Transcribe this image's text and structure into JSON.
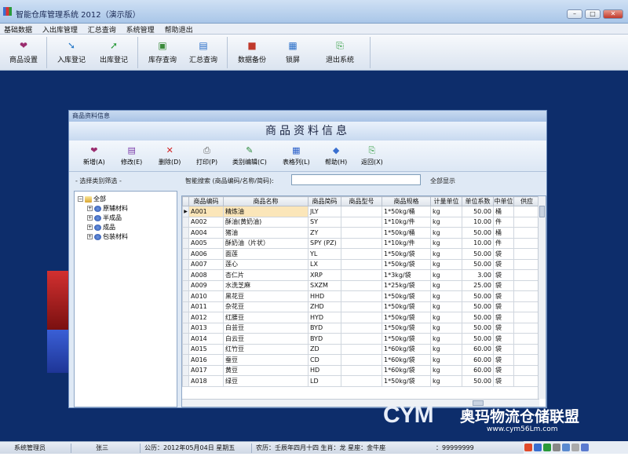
{
  "window": {
    "title": "智能仓库管理系统 2012（演示版）",
    "buttons": {
      "minimize": "–",
      "maximize": "□",
      "close": "✕"
    }
  },
  "menubar": [
    "基础数据",
    "入出库管理",
    "汇总查询",
    "系统管理",
    "帮助退出"
  ],
  "toolbar": {
    "groups": [
      [
        {
          "label": "商品设置",
          "icon": "goods-settings-icon"
        }
      ],
      [
        {
          "label": "入库登记",
          "icon": "stock-in-icon"
        },
        {
          "label": "出库登记",
          "icon": "stock-out-icon"
        }
      ],
      [
        {
          "label": "库存查询",
          "icon": "inventory-query-icon"
        },
        {
          "label": "汇总查询",
          "icon": "summary-query-icon"
        }
      ],
      [
        {
          "label": "数据备份",
          "icon": "backup-icon"
        },
        {
          "label": "锁屏",
          "icon": "lock-screen-icon"
        },
        {
          "label": "退出系统",
          "icon": "exit-icon"
        }
      ]
    ]
  },
  "dialog": {
    "title": "商品资料信息",
    "banner": "商品资料信息",
    "buttons": [
      {
        "label": "新增(A)",
        "icon": "add-icon"
      },
      {
        "label": "修改(E)",
        "icon": "edit-icon"
      },
      {
        "label": "删除(D)",
        "icon": "delete-icon"
      },
      {
        "label": "打印(P)",
        "icon": "print-icon"
      },
      {
        "label": "类别编辑(C)",
        "icon": "category-edit-icon"
      },
      {
        "label": "表格列(L)",
        "icon": "table-columns-icon"
      },
      {
        "label": "帮助(H)",
        "icon": "help-icon"
      },
      {
        "label": "返回(X)",
        "icon": "return-icon"
      }
    ],
    "category_caption": "- 选择类别筛选 -",
    "search_label": "智能搜索 (商品编码/名称/简码):",
    "search_value": "",
    "show_all": "全部显示",
    "tree": [
      {
        "label": "全部",
        "level": 0,
        "expander": "−"
      },
      {
        "label": "原辅材料",
        "level": 1,
        "expander": "+"
      },
      {
        "label": "半成品",
        "level": 1,
        "expander": "+"
      },
      {
        "label": "成品",
        "level": 1,
        "expander": "+"
      },
      {
        "label": "包装材料",
        "level": 1,
        "expander": "+"
      }
    ],
    "table": {
      "columns": [
        "商品编码",
        "商品名称",
        "商品简码",
        "商品型号",
        "商品规格",
        "计量单位",
        "单位系数",
        "中单位",
        "供应"
      ],
      "rows": [
        [
          "A001",
          "精炼油",
          "JLY",
          "",
          "1*50kg/桶",
          "kg",
          "50.00",
          "桶",
          ""
        ],
        [
          "A002",
          "酥油(黄奶油)",
          "SY",
          "",
          "1*10kg/件",
          "kg",
          "10.00",
          "件",
          ""
        ],
        [
          "A004",
          "猪油",
          "ZY",
          "",
          "1*50kg/桶",
          "kg",
          "50.00",
          "桶",
          ""
        ],
        [
          "A005",
          "酥奶油（片状）",
          "SPY (PZ)",
          "",
          "1*10kg/件",
          "kg",
          "10.00",
          "件",
          ""
        ],
        [
          "A006",
          "面莲",
          "YL",
          "",
          "1*50kg/袋",
          "kg",
          "50.00",
          "袋",
          ""
        ],
        [
          "A007",
          "莲心",
          "LX",
          "",
          "1*50kg/袋",
          "kg",
          "50.00",
          "袋",
          ""
        ],
        [
          "A008",
          "杏仁片",
          "XRP",
          "",
          "1*3kg/袋",
          "kg",
          "3.00",
          "袋",
          ""
        ],
        [
          "A009",
          "水洗芝麻",
          "SXZM",
          "",
          "1*25kg/袋",
          "kg",
          "25.00",
          "袋",
          ""
        ],
        [
          "A010",
          "黑花豆",
          "HHD",
          "",
          "1*50kg/袋",
          "kg",
          "50.00",
          "袋",
          ""
        ],
        [
          "A011",
          "杂花豆",
          "ZHD",
          "",
          "1*50kg/袋",
          "kg",
          "50.00",
          "袋",
          ""
        ],
        [
          "A012",
          "红腰豆",
          "HYD",
          "",
          "1*50kg/袋",
          "kg",
          "50.00",
          "袋",
          ""
        ],
        [
          "A013",
          "白芸豆",
          "BYD",
          "",
          "1*50kg/袋",
          "kg",
          "50.00",
          "袋",
          ""
        ],
        [
          "A014",
          "白云豆",
          "BYD",
          "",
          "1*50kg/袋",
          "kg",
          "50.00",
          "袋",
          ""
        ],
        [
          "A015",
          "红竹豆",
          "ZD",
          "",
          "1*60kg/袋",
          "kg",
          "60.00",
          "袋",
          ""
        ],
        [
          "A016",
          "蚕豆",
          "CD",
          "",
          "1*60kg/袋",
          "kg",
          "60.00",
          "袋",
          ""
        ],
        [
          "A017",
          "黄豆",
          "HD",
          "",
          "1*60kg/袋",
          "kg",
          "60.00",
          "袋",
          ""
        ],
        [
          "A018",
          "绿豆",
          "LD",
          "",
          "1*50kg/袋",
          "kg",
          "50.00",
          "袋",
          ""
        ]
      ],
      "selected_row": 0
    }
  },
  "watermark": {
    "logo": "CYM",
    "name": "奥玛物流仓储联盟",
    "url": "www.cym56Lm.com"
  },
  "statusbar": {
    "role": "系统管理员",
    "user": "张三",
    "gregorian": "公历：2012年05月04日 星期五",
    "lunar": "农历：壬辰年四月十四 生肖：龙 星座：金牛座",
    "phone": "：99999999"
  },
  "colors": {
    "desktop": "#0d2d6b",
    "selected_cell": "#fbe6b9",
    "dialog_bg": "#dfe9f5"
  }
}
